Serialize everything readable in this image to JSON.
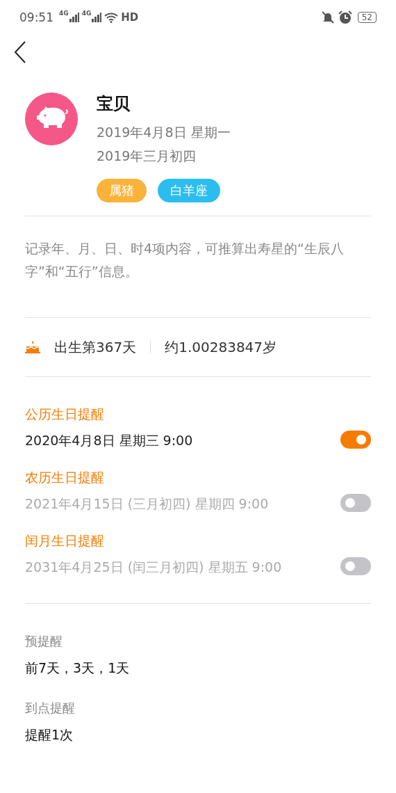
{
  "status_bar": {
    "time": "09:51",
    "network_1": "4G",
    "network_2": "4G",
    "hd": "HD",
    "battery": "52"
  },
  "profile": {
    "name": "宝贝",
    "solar_date": "2019年4月8日 星期一",
    "lunar_date": "2019年三月初四",
    "tags": [
      {
        "label": "属猪",
        "color": "#f9b23a"
      },
      {
        "label": "白羊座",
        "color": "#2bbdf0"
      }
    ]
  },
  "description": "记录年、月、日、时4项内容，可推算出寿星的“生辰八字”和“五行”信息。",
  "age": {
    "days": "出生第367天",
    "years": "约1.00283847岁"
  },
  "reminders": [
    {
      "title": "公历生日提醒",
      "datetime": "2020年4月8日 星期三 9:00",
      "on": true
    },
    {
      "title": "农历生日提醒",
      "datetime": "2021年4月15日 (三月初四) 星期四 9:00",
      "on": false
    },
    {
      "title": "闰月生日提醒",
      "datetime": "2031年4月25日 (闰三月初四) 星期五 9:00",
      "on": false
    }
  ],
  "settings": [
    {
      "label": "预提醒",
      "value": "前7天，3天，1天"
    },
    {
      "label": "到点提醒",
      "value": "提醒1次"
    }
  ]
}
